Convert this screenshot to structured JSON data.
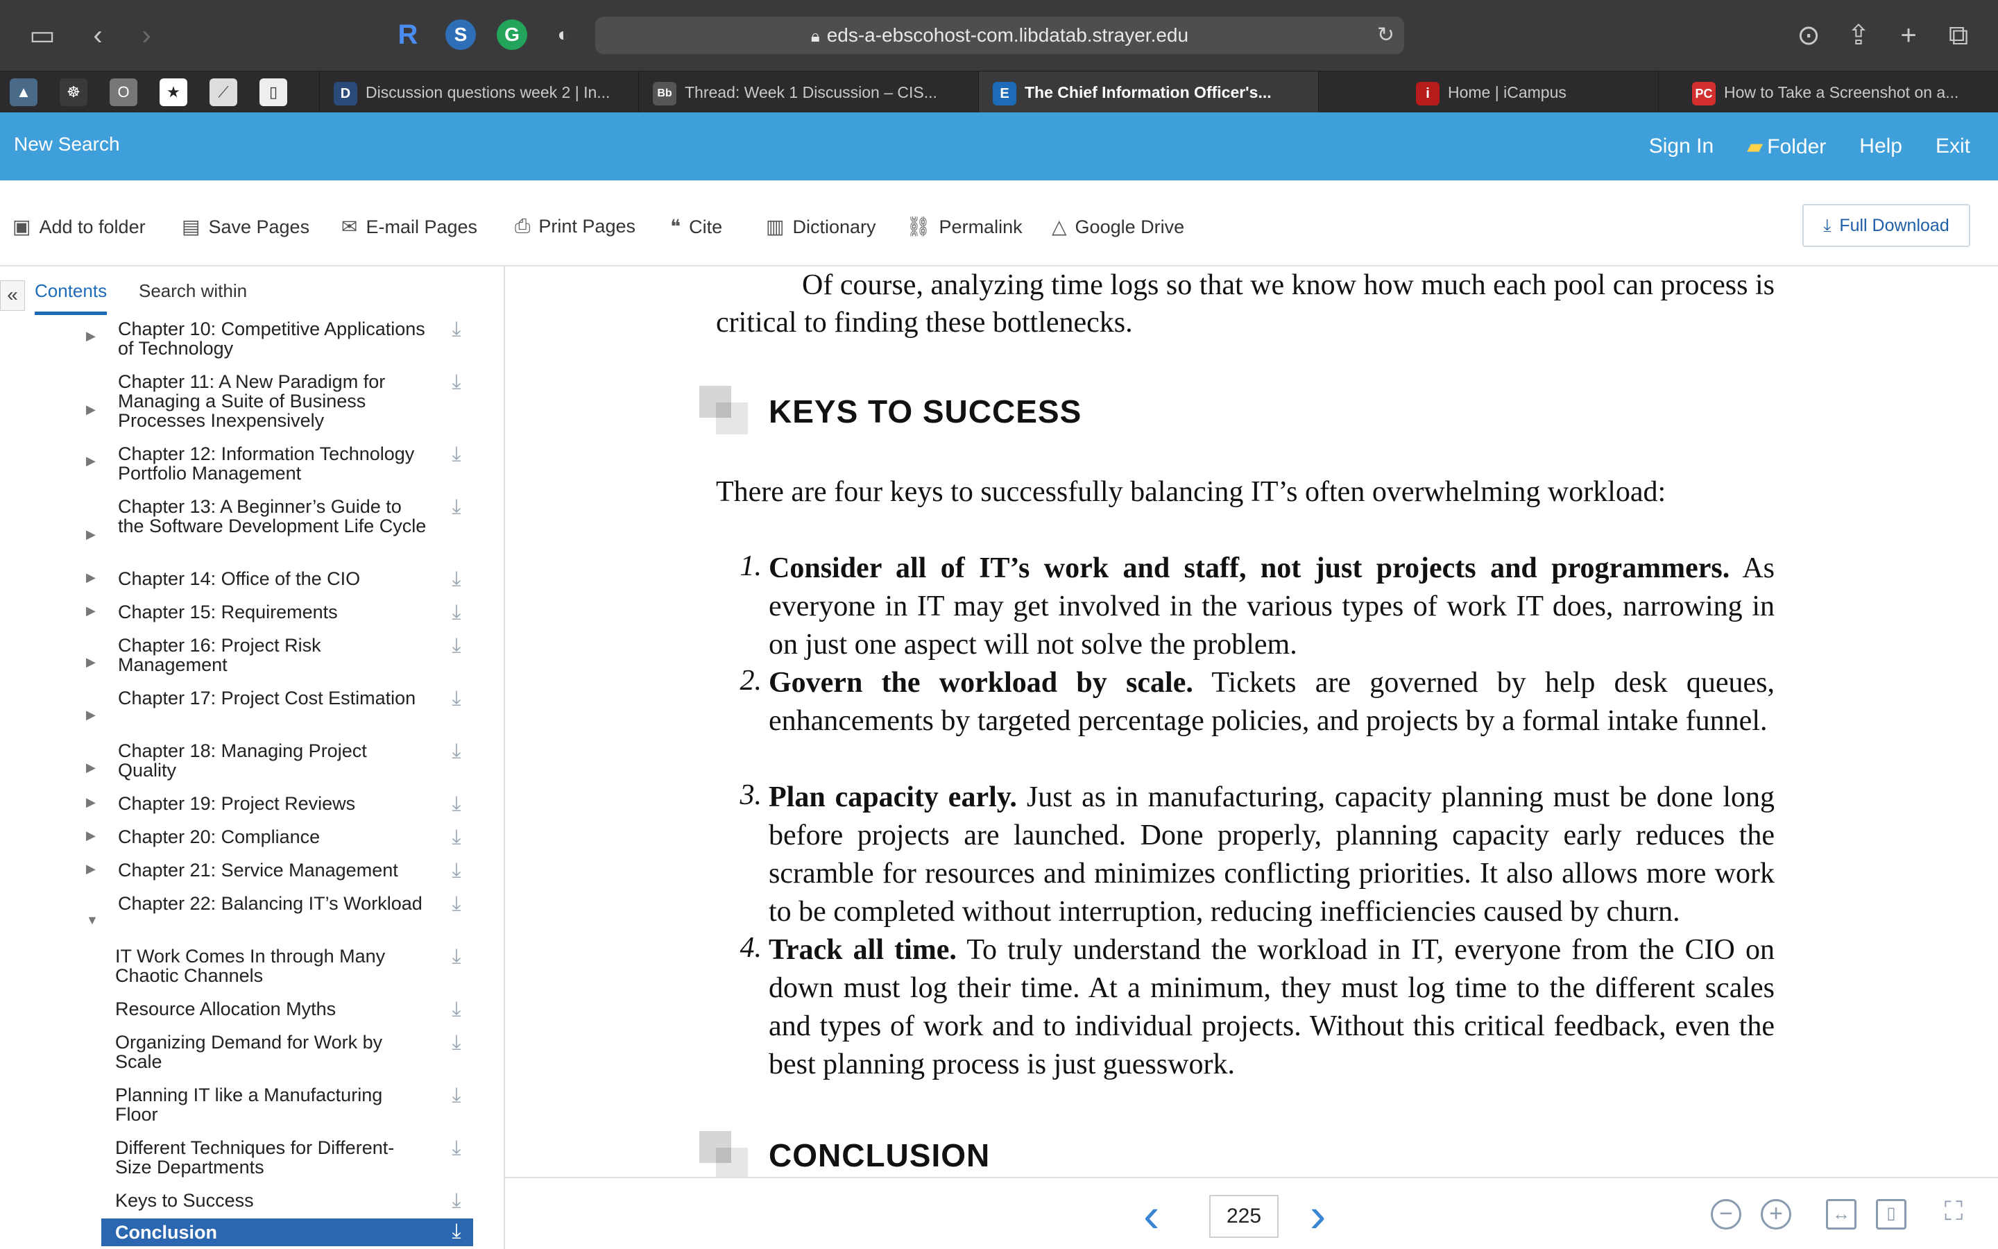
{
  "browser": {
    "url": "eds-a-ebscohost-com.libdatab.strayer.edu",
    "tabs": [
      {
        "label": "Discussion questions week 2 | In...",
        "icon": "D"
      },
      {
        "label": "Thread: Week 1 Discussion – CIS...",
        "icon": "Bb"
      },
      {
        "label": "The Chief Information Officer's...",
        "icon": "E"
      },
      {
        "label": "Home | iCampus",
        "icon": "i"
      },
      {
        "label": "How to Take a Screenshot on a...",
        "icon": "PC"
      }
    ]
  },
  "header": {
    "new_search": "New Search",
    "links": [
      "Sign In",
      "Folder",
      "Help",
      "Exit"
    ]
  },
  "toolbar": {
    "items": [
      "Add to folder",
      "Save Pages",
      "E-mail Pages",
      "Print Pages",
      "Cite",
      "Dictionary",
      "Permalink",
      "Google Drive"
    ],
    "full_download": "Full Download"
  },
  "sidebar": {
    "tabs": [
      "Contents",
      "Search within"
    ],
    "items": [
      {
        "label": "Chapter 10: Competitive Applications of Technology"
      },
      {
        "label": "Chapter 11: A New Paradigm for Managing a Suite of Business Processes Inexpensively"
      },
      {
        "label": "Chapter 12: Information Technology Portfolio Management"
      },
      {
        "label": "Chapter 13: A Beginner’s Guide to the Software Development Life Cycle"
      },
      {
        "label": "Chapter 14: Office of the CIO"
      },
      {
        "label": "Chapter 15: Requirements"
      },
      {
        "label": "Chapter 16: Project Risk Management"
      },
      {
        "label": "Chapter 17: Project Cost Estimation"
      },
      {
        "label": "Chapter 18: Managing Project Quality"
      },
      {
        "label": "Chapter 19: Project Reviews"
      },
      {
        "label": "Chapter 20: Compliance"
      },
      {
        "label": "Chapter 21: Service Management"
      },
      {
        "label": "Chapter 22: Balancing IT’s Workload"
      },
      {
        "label": "IT Work Comes In through Many Chaotic Channels"
      },
      {
        "label": "Resource Allocation Myths"
      },
      {
        "label": "Organizing Demand for Work by Scale"
      },
      {
        "label": "Planning IT like a Manufacturing Floor"
      },
      {
        "label": "Different Techniques for Different- Size Departments"
      },
      {
        "label": "Keys to Success"
      },
      {
        "label": "Conclusion"
      }
    ]
  },
  "reader": {
    "intro_line1": "Of course, analyzing time logs so that we know how much each pool can process is",
    "intro_line2": "critical to finding these bottlenecks.",
    "heading_keys": "KEYS TO SUCCESS",
    "lead": "There are four keys to successfully balancing IT’s often overwhelming workload:",
    "list": [
      {
        "num": "1.",
        "bold": "Consider all of IT’s work and staff, not just projects and programmers.",
        "text": " As everyone in IT may get involved in the various types of work IT does, narrowing in on just one aspect will not solve the problem."
      },
      {
        "num": "2.",
        "bold": "Govern the workload by scale.",
        "text": " Tickets are governed by help desk queues, enhancements by targeted percentage policies, and projects by a formal intake funnel."
      },
      {
        "num": "3.",
        "bold": "Plan capacity early.",
        "text": " Just as in manufacturing, capacity planning must be done long before projects are launched. Done properly, planning capacity early reduces the scramble for resources and minimizes conflicting priorities. It also allows more work to be completed without interruption, reducing inefficiencies caused by churn."
      },
      {
        "num": "4.",
        "bold": "Track all time.",
        "text": " To truly understand the workload in IT, everyone from the CIO on down must log their time. At a minimum, they must log time to the different scales and types of work and to individual projects. Without this critical feedback, even the best planning process is just guesswork."
      }
    ],
    "heading_conclusion": "CONCLUSION"
  },
  "pager": {
    "page": "225"
  }
}
